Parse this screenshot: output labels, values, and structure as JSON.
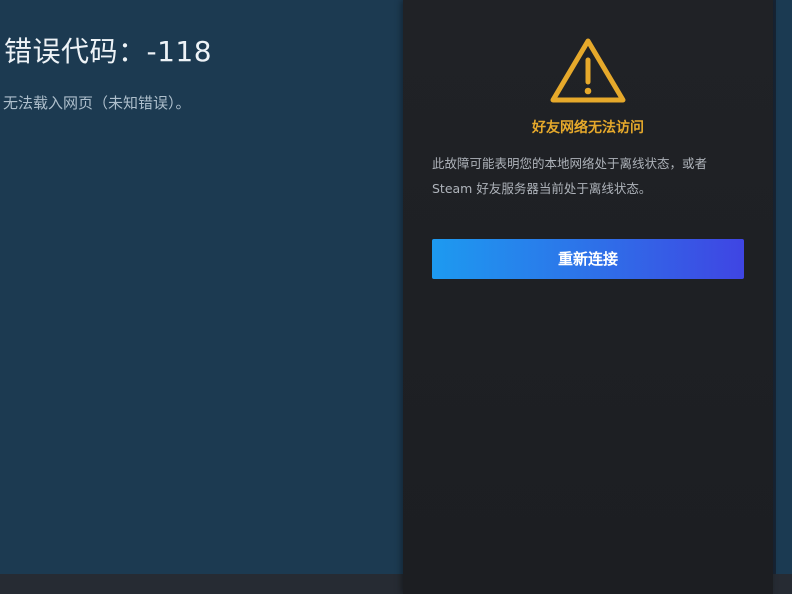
{
  "error": {
    "title": "错误代码：-118",
    "description": "无法载入网页（未知错误）。"
  },
  "friends_panel": {
    "icon": "warning-triangle-icon",
    "title": "好友网络无法访问",
    "body": "此故障可能表明您的本地网络处于离线状态，或者 Steam 好友服务器当前处于离线状态。",
    "reconnect_label": "重新连接"
  },
  "colors": {
    "page_background": "#1b3a52",
    "panel_background": "#1e2024",
    "warning_accent": "#e6a92b",
    "button_gradient_start": "#1d9af0",
    "button_gradient_end": "#3f45e3"
  }
}
